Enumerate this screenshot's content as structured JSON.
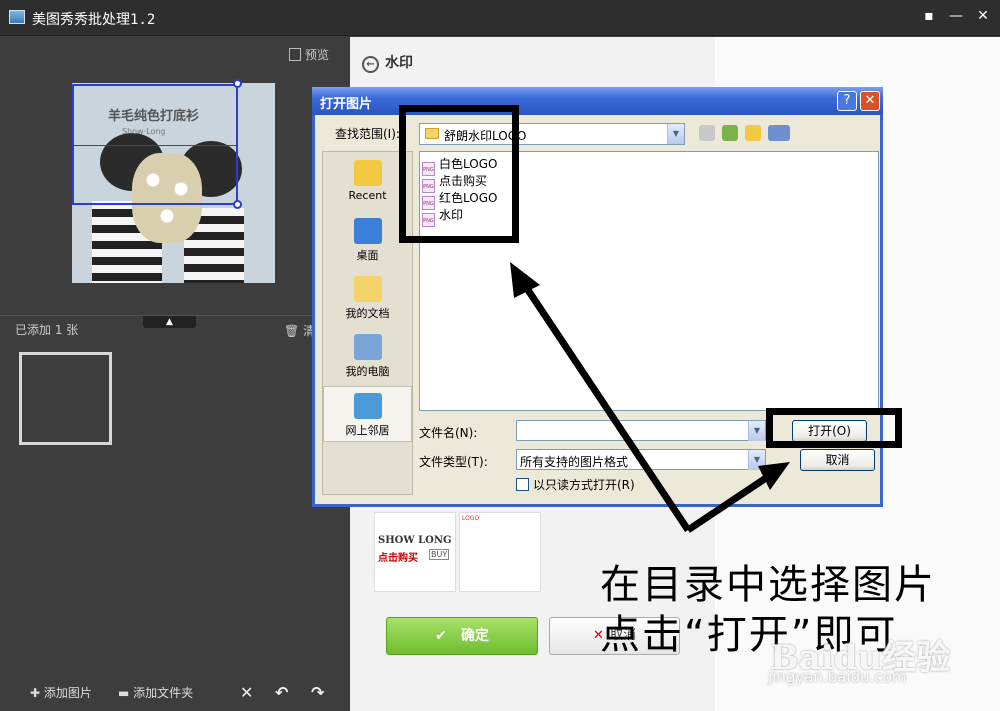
{
  "window": {
    "title": "美图秀秀批处理1.2",
    "controls": [
      "▪",
      "—",
      "✕"
    ]
  },
  "left": {
    "preview_label": "预览",
    "preview_watermark_text": "羊毛纯色打底衫",
    "preview_watermark_sub": "Show·Long",
    "added_count": "已添加 1 张",
    "clear_label": "清",
    "collapse": "▲",
    "toolbar": {
      "add_image": "添加图片",
      "add_folder": "添加文件夹",
      "delete": "✕",
      "rotate_left": "↶",
      "rotate_right": "↷"
    }
  },
  "right": {
    "header": "水印",
    "thumb1": {
      "line1": "SHOW  LONG",
      "line2": "点击购买",
      "badge": "BUY"
    },
    "thumb2": {
      "text": "LOGO"
    },
    "ok_label": "确定",
    "cancel_label": "取消"
  },
  "dialog": {
    "title": "打开图片",
    "help": "?",
    "close": "✕",
    "look_in_label": "查找范围(I):",
    "look_in_value": "舒朗水印LOGO",
    "places": [
      "Recent",
      "桌面",
      "我的文档",
      "我的电脑",
      "网上邻居"
    ],
    "files": [
      "白色LOGO",
      "点击购买",
      "红色LOGO",
      "水印"
    ],
    "file_name_label": "文件名(N):",
    "file_name_value": "",
    "file_type_label": "文件类型(T):",
    "file_type_value": "所有支持的图片格式",
    "open_button": "打开(O)",
    "cancel_button": "取消",
    "readonly_label": "以只读方式打开(R)"
  },
  "annotation": {
    "line1": "在目录中选择图片",
    "line2": "点击“打开”即可"
  },
  "watermark": {
    "brand": "Baidu经验",
    "url": "jingyan.baidu.com"
  },
  "colors": {
    "dialog_title": "#2a55c0",
    "ok_green": "#6fbe2e",
    "selection_blue": "#2a3fd0"
  }
}
